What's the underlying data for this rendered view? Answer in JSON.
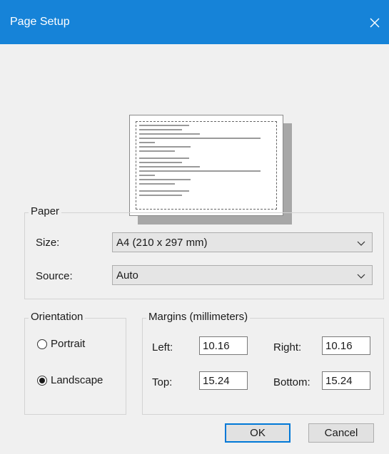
{
  "window": {
    "title": "Page Setup"
  },
  "paper": {
    "group_label": "Paper",
    "size_label": "Size:",
    "size_value": "A4 (210 x 297 mm)",
    "source_label": "Source:",
    "source_value": "Auto"
  },
  "orientation": {
    "group_label": "Orientation",
    "portrait_label": "Portrait",
    "landscape_label": "Landscape",
    "selected": "Landscape"
  },
  "margins": {
    "group_label": "Margins (millimeters)",
    "left_label": "Left:",
    "left_value": "10.16",
    "right_label": "Right:",
    "right_value": "10.16",
    "top_label": "Top:",
    "top_value": "15.24",
    "bottom_label": "Bottom:",
    "bottom_value": "15.24"
  },
  "buttons": {
    "ok": "OK",
    "cancel": "Cancel"
  },
  "colors": {
    "titlebar": "#1683d8",
    "background": "#f0f0f0",
    "accent": "#0078d7"
  }
}
